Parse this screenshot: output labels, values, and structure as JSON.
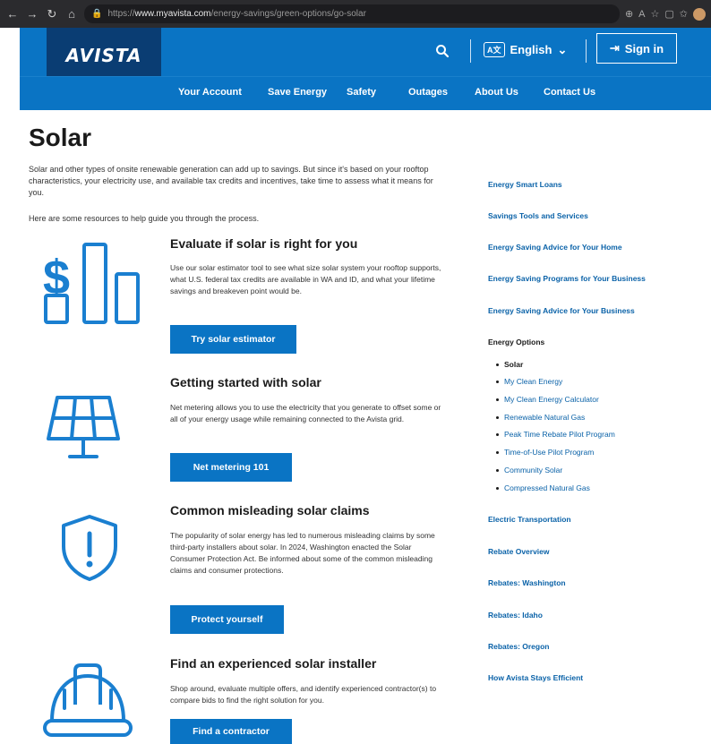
{
  "browser": {
    "url_prefix": "https://",
    "url_domain": "www.myavista.com",
    "url_path": "/energy-savings/green-options/go-solar"
  },
  "header": {
    "logo": "AVISTA",
    "language": "English",
    "language_icon": "A文",
    "sign_in": "Sign in"
  },
  "nav": {
    "items": [
      "Your Account",
      "Save Energy",
      "Safety",
      "Outages",
      "About Us",
      "Contact Us"
    ]
  },
  "main": {
    "title": "Solar",
    "intro_1": "Solar and other types of onsite renewable generation can add up to savings. But since it's based on your rooftop characteristics, your electricity use, and available tax credits and incentives, take time to assess what it means for you.",
    "intro_2": "Here are some resources to help guide you through the process.",
    "sections": [
      {
        "title": "Evaluate if solar is right for you",
        "body": "Use our solar estimator tool to see what size solar system your rooftop supports, what U.S. federal tax credits are available in WA and ID, and what your lifetime savings and breakeven point would be.",
        "button": "Try solar estimator",
        "icon": "savings-chart-icon"
      },
      {
        "title": "Getting started with solar",
        "body": "Net metering allows you to use the electricity that you generate to offset some or all of your energy usage while remaining connected to the Avista grid.",
        "button": "Net metering 101",
        "icon": "solar-panel-icon"
      },
      {
        "title": "Common misleading solar claims",
        "body": "The popularity of solar energy has led to numerous misleading claims by some third-party installers about solar. In 2024, Washington enacted the Solar Consumer Protection Act. Be informed about some of the common misleading claims and consumer protections.",
        "button": "Protect yourself",
        "icon": "shield-alert-icon"
      },
      {
        "title": "Find an experienced solar installer",
        "body": "Shop around, evaluate multiple offers, and identify experienced contractor(s) to compare bids to find the right solution for you.",
        "button": "Find a contractor",
        "icon": "hard-hat-icon"
      }
    ]
  },
  "sidebar": {
    "links_top": [
      "Energy Smart Loans",
      "Savings Tools and Services",
      "Energy Saving Advice for Your Home",
      "Energy Saving Programs for Your Business",
      "Energy Saving Advice for Your Business"
    ],
    "energy_options_heading": "Energy Options",
    "energy_options": [
      "Solar",
      "My Clean Energy",
      "My Clean Energy Calculator",
      "Renewable Natural Gas",
      "Peak Time Rebate Pilot Program",
      "Time-of-Use Pilot Program",
      "Community Solar",
      "Compressed Natural Gas"
    ],
    "links_bottom": [
      "Electric Transportation",
      "Rebate Overview",
      "Rebates: Washington",
      "Rebates: Idaho",
      "Rebates: Oregon",
      "How Avista Stays Efficient"
    ]
  },
  "colors": {
    "brand_blue": "#0a74c4",
    "logo_navy": "#0a3d73",
    "accent_orange": "#f7931e",
    "link_blue": "#0a62a8"
  }
}
